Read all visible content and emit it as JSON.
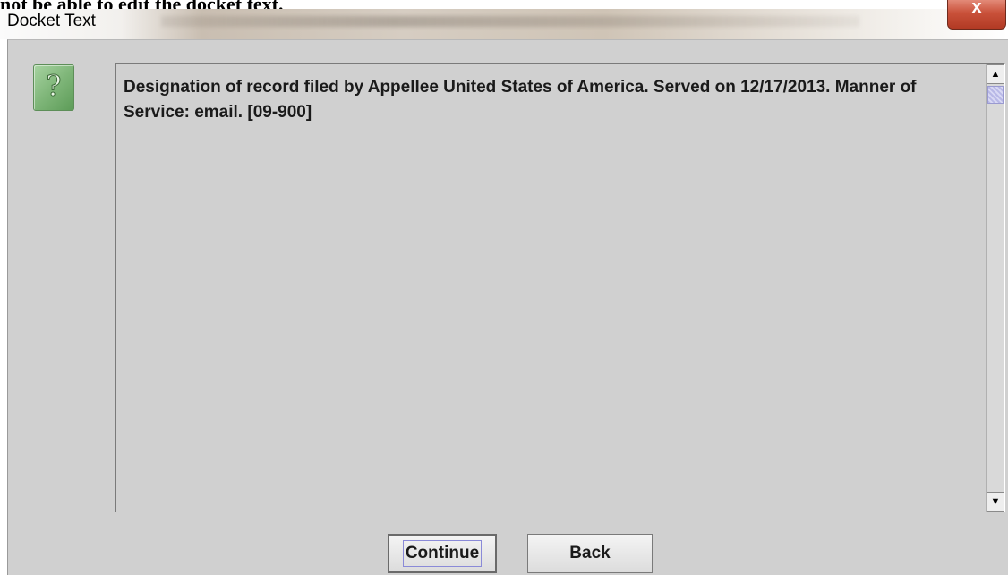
{
  "background_doc": {
    "heading_text": "not be able to edit the docket text."
  },
  "window": {
    "title": "Docket Text",
    "close_label": "x"
  },
  "dialog": {
    "icon": "question-mark-icon",
    "icon_glyph": "?",
    "docket_text": "Designation of record filed by Appellee United States of America. Served on 12/17/2013. Manner of Service: email. [09-900]",
    "scroll_up_glyph": "▲",
    "scroll_down_glyph": "▼"
  },
  "buttons": {
    "continue_label": "Continue",
    "back_label": "Back"
  },
  "colors": {
    "dialog_bg": "#d0d0d0",
    "close_button": "#c9513a",
    "icon_green": "#7fb679"
  }
}
